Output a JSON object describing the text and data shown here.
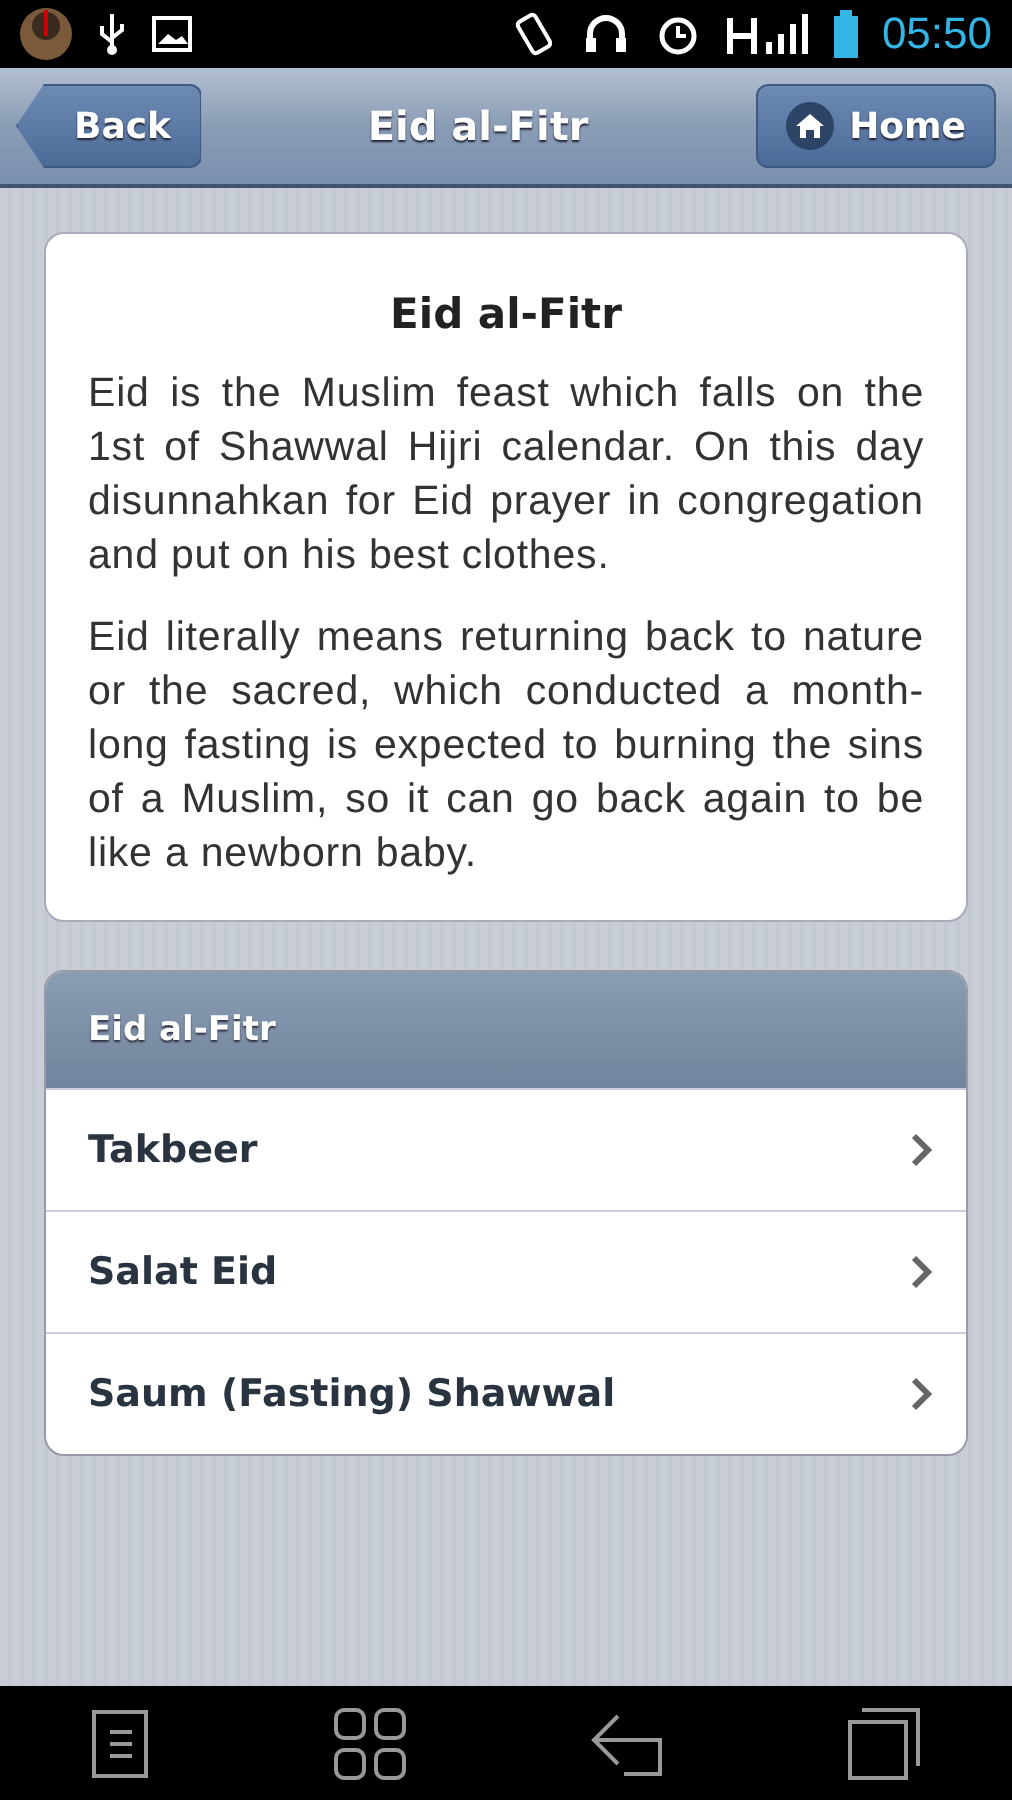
{
  "status_bar": {
    "time": "05:50"
  },
  "header": {
    "back": "Back",
    "title": "Eid al-Fitr",
    "home": "Home"
  },
  "card": {
    "title": "Eid al-Fitr",
    "paragraphs": [
      "Eid is the Muslim feast which falls on the 1st of Shawwal Hijri calendar. On this day disunnahkan for Eid prayer in congregation and put on his best clothes.",
      "Eid literally means returning back to nature or the sacred, which conducted a month-long fasting is expected to burning the sins of a Muslim, so it can go back again to be like a newborn baby."
    ]
  },
  "list": {
    "header": "Eid al-Fitr",
    "items": [
      {
        "label": "Takbeer"
      },
      {
        "label": "Salat Eid"
      },
      {
        "label": "Saum (Fasting) Shawwal"
      }
    ]
  }
}
